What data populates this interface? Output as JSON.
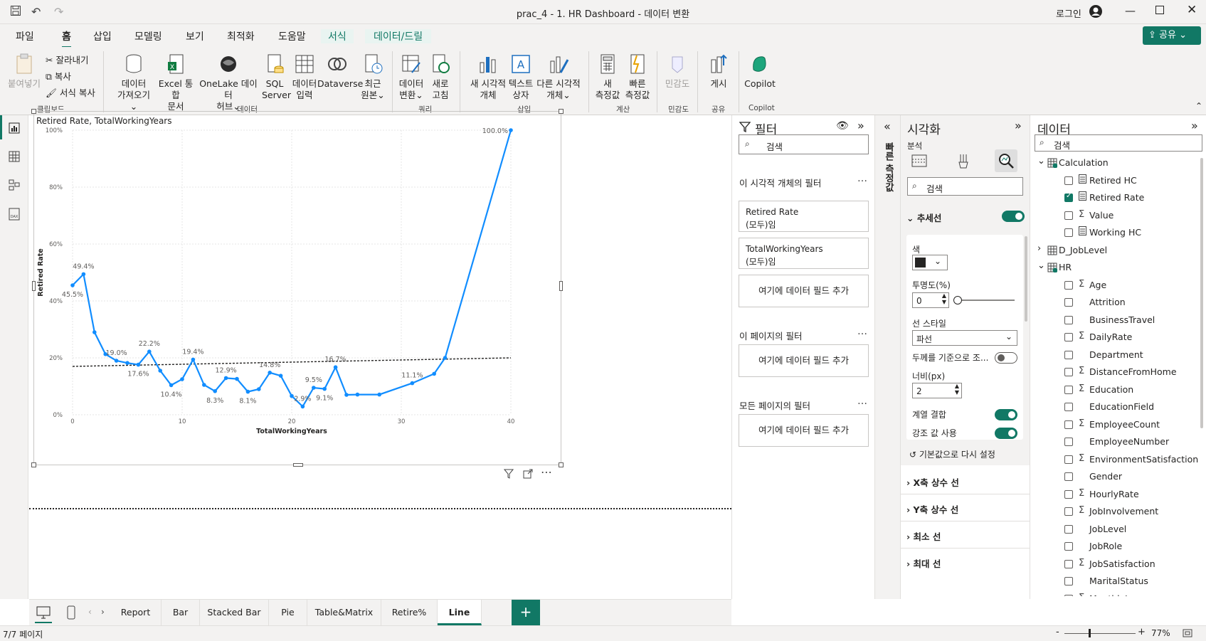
{
  "window": {
    "title": "prac_4 - 1. HR Dashboard - 데이터 변환",
    "login": "로그인"
  },
  "menu": {
    "items": [
      "파일",
      "홈",
      "삽입",
      "모델링",
      "보기",
      "최적화",
      "도움말",
      "서식",
      "데이터/드릴"
    ],
    "active": "홈",
    "share": "공유"
  },
  "ribbon": {
    "paste": "붙여넣기",
    "cut": "잘라내기",
    "copy": "복사",
    "format_copy": "서식 복사",
    "group_clipboard": "클립보드",
    "get_data": [
      "데이터",
      "가져오기"
    ],
    "excel": [
      "Excel 통합",
      "문서"
    ],
    "onelake": [
      "OneLake 데이터",
      "허브"
    ],
    "sql": [
      "SQL",
      "Server"
    ],
    "enter_data": [
      "데이터",
      "입력"
    ],
    "dataverse": "Dataverse",
    "recent": [
      "최근",
      "원본"
    ],
    "group_data": "데이터",
    "transform": [
      "데이터",
      "변환"
    ],
    "refresh": [
      "새로",
      "고침"
    ],
    "group_query": "쿼리",
    "new_visual": [
      "새 시각적",
      "개체"
    ],
    "textbox": [
      "텍스트",
      "상자"
    ],
    "more_visuals": [
      "다른 시각적",
      "개체"
    ],
    "group_insert": "삽입",
    "new_measure": [
      "새",
      "측정값"
    ],
    "quick_measure": [
      "빠른",
      "측정값"
    ],
    "group_calc": "계산",
    "sensitivity": "민감도",
    "group_sensitivity": "민감도",
    "publish": "게시",
    "group_share": "공유",
    "copilot": "Copilot",
    "group_copilot": "Copilot"
  },
  "visual": {
    "title": "Retired Rate, TotalWorkingYears"
  },
  "chart_data": {
    "type": "line",
    "xlabel": "TotalWorkingYears",
    "ylabel": "Retired Rate",
    "xlim": [
      0,
      40
    ],
    "ylim": [
      0,
      100
    ],
    "xticks": [
      "0",
      "10",
      "20",
      "30",
      "40"
    ],
    "yticks": [
      "0%",
      "20%",
      "40%",
      "60%",
      "80%",
      "100%"
    ],
    "x": [
      0,
      1,
      2,
      3,
      4,
      5,
      6,
      7,
      8,
      9,
      10,
      11,
      12,
      13,
      14,
      15,
      16,
      17,
      18,
      19,
      20,
      21,
      22,
      23,
      24,
      25,
      26,
      28,
      31,
      33,
      34,
      40
    ],
    "y": [
      45.5,
      49.4,
      29,
      21.3,
      19.0,
      18.2,
      17.6,
      22.2,
      15.5,
      10.4,
      12.5,
      19.4,
      10.5,
      8.3,
      12.9,
      12.6,
      8.1,
      9.0,
      14.8,
      13.7,
      6.6,
      2.9,
      9.5,
      9.1,
      16.7,
      7.0,
      7.1,
      7.1,
      11.1,
      14.4,
      20.0,
      100.0
    ],
    "labels": [
      {
        "x": 0,
        "y": 45.5,
        "t": "45.5%",
        "pos": "below"
      },
      {
        "x": 1,
        "y": 49.4,
        "t": "49.4%",
        "pos": "above"
      },
      {
        "x": 4,
        "y": 19.0,
        "t": "19.0%",
        "pos": "above"
      },
      {
        "x": 6,
        "y": 17.6,
        "t": "17.6%",
        "pos": "below"
      },
      {
        "x": 7,
        "y": 22.2,
        "t": "22.2%",
        "pos": "above"
      },
      {
        "x": 9,
        "y": 10.4,
        "t": "10.4%",
        "pos": "below"
      },
      {
        "x": 11,
        "y": 19.4,
        "t": "19.4%",
        "pos": "above"
      },
      {
        "x": 13,
        "y": 8.3,
        "t": "8.3%",
        "pos": "below"
      },
      {
        "x": 14,
        "y": 12.9,
        "t": "12.9%",
        "pos": "above"
      },
      {
        "x": 16,
        "y": 8.1,
        "t": "8.1%",
        "pos": "below"
      },
      {
        "x": 18,
        "y": 14.8,
        "t": "14.8%",
        "pos": "above"
      },
      {
        "x": 21,
        "y": 2.9,
        "t": "2.9%",
        "pos": "above"
      },
      {
        "x": 22,
        "y": 9.5,
        "t": "9.5%",
        "pos": "above"
      },
      {
        "x": 23,
        "y": 9.1,
        "t": "9.1%",
        "pos": "below"
      },
      {
        "x": 24,
        "y": 16.7,
        "t": "16.7%",
        "pos": "above"
      },
      {
        "x": 31,
        "y": 11.1,
        "t": "11.1%",
        "pos": "above"
      },
      {
        "x": 40,
        "y": 100.0,
        "t": "100.0%",
        "pos": "left"
      }
    ],
    "trend": {
      "y0": 17.0,
      "y1": 20.0
    },
    "line_color": "#118DFF",
    "grid": true
  },
  "filters": {
    "title": "필터",
    "search": "검색",
    "visual_filters": "이 시각적 개체의 필터",
    "cards": [
      {
        "name": "Retired Rate",
        "state": "(모두)임"
      },
      {
        "name": "TotalWorkingYears",
        "state": "(모두)임"
      }
    ],
    "add_field": "여기에 데이터 필드 추가",
    "page_filters": "이 페이지의 필터",
    "all_page_filters": "모든 페이지의 필터",
    "more": "…"
  },
  "quick_measure": "빠른 측정값",
  "viz": {
    "title": "시각화",
    "tab": "분석",
    "search": "검색",
    "trendline": "추세선",
    "color_label": "색",
    "opacity_label": "투명도(%)",
    "opacity_value": "0",
    "style_label": "선 스타일",
    "style_value": "파선",
    "thickness_label": "두께를 기준으로 조...",
    "width_label": "너비(px)",
    "width_value": "2",
    "combine_series": "계열 결합",
    "use_highlight": "강조 값 사용",
    "reset": "기본값으로 다시 설정",
    "sections": [
      "X축 상수 선",
      "Y축 상수 선",
      "최소 선",
      "최대 선"
    ]
  },
  "data": {
    "title": "데이터",
    "search": "검색",
    "tables": [
      {
        "name": "Calculation",
        "fields": [
          {
            "name": "Retired HC",
            "checked": false,
            "sigma": false
          },
          {
            "name": "Retired Rate",
            "checked": true,
            "sigma": false
          },
          {
            "name": "Value",
            "checked": false,
            "sigma": true
          },
          {
            "name": "Working HC",
            "checked": false,
            "sigma": false
          }
        ]
      },
      {
        "name": "D_JobLevel",
        "fields": []
      },
      {
        "name": "HR",
        "fields": [
          {
            "name": "Age",
            "checked": false,
            "sigma": true
          },
          {
            "name": "Attrition",
            "checked": false,
            "sigma": false
          },
          {
            "name": "BusinessTravel",
            "checked": false,
            "sigma": false
          },
          {
            "name": "DailyRate",
            "checked": false,
            "sigma": true
          },
          {
            "name": "Department",
            "checked": false,
            "sigma": false
          },
          {
            "name": "DistanceFromHome",
            "checked": false,
            "sigma": true
          },
          {
            "name": "Education",
            "checked": false,
            "sigma": true
          },
          {
            "name": "EducationField",
            "checked": false,
            "sigma": false
          },
          {
            "name": "EmployeeCount",
            "checked": false,
            "sigma": true
          },
          {
            "name": "EmployeeNumber",
            "checked": false,
            "sigma": false
          },
          {
            "name": "EnvironmentSatisfaction",
            "checked": false,
            "sigma": true
          },
          {
            "name": "Gender",
            "checked": false,
            "sigma": false
          },
          {
            "name": "HourlyRate",
            "checked": false,
            "sigma": true
          },
          {
            "name": "JobInvolvement",
            "checked": false,
            "sigma": true
          },
          {
            "name": "JobLevel",
            "checked": false,
            "sigma": false
          },
          {
            "name": "JobRole",
            "checked": false,
            "sigma": false
          },
          {
            "name": "JobSatisfaction",
            "checked": false,
            "sigma": true
          },
          {
            "name": "MaritalStatus",
            "checked": false,
            "sigma": false
          },
          {
            "name": "MonthlyIncome",
            "checked": false,
            "sigma": true
          }
        ]
      }
    ]
  },
  "tabs": {
    "items": [
      "Report",
      "Bar",
      "Stacked Bar",
      "Pie",
      "Table&Matrix",
      "Retire%",
      "Line"
    ],
    "active": "Line",
    "add": "+"
  },
  "status": {
    "page": "7/7 페이지",
    "zoom": "77%",
    "minus": "-",
    "plus": "+"
  },
  "colors": {
    "accent": "#117865",
    "line": "#118DFF"
  }
}
